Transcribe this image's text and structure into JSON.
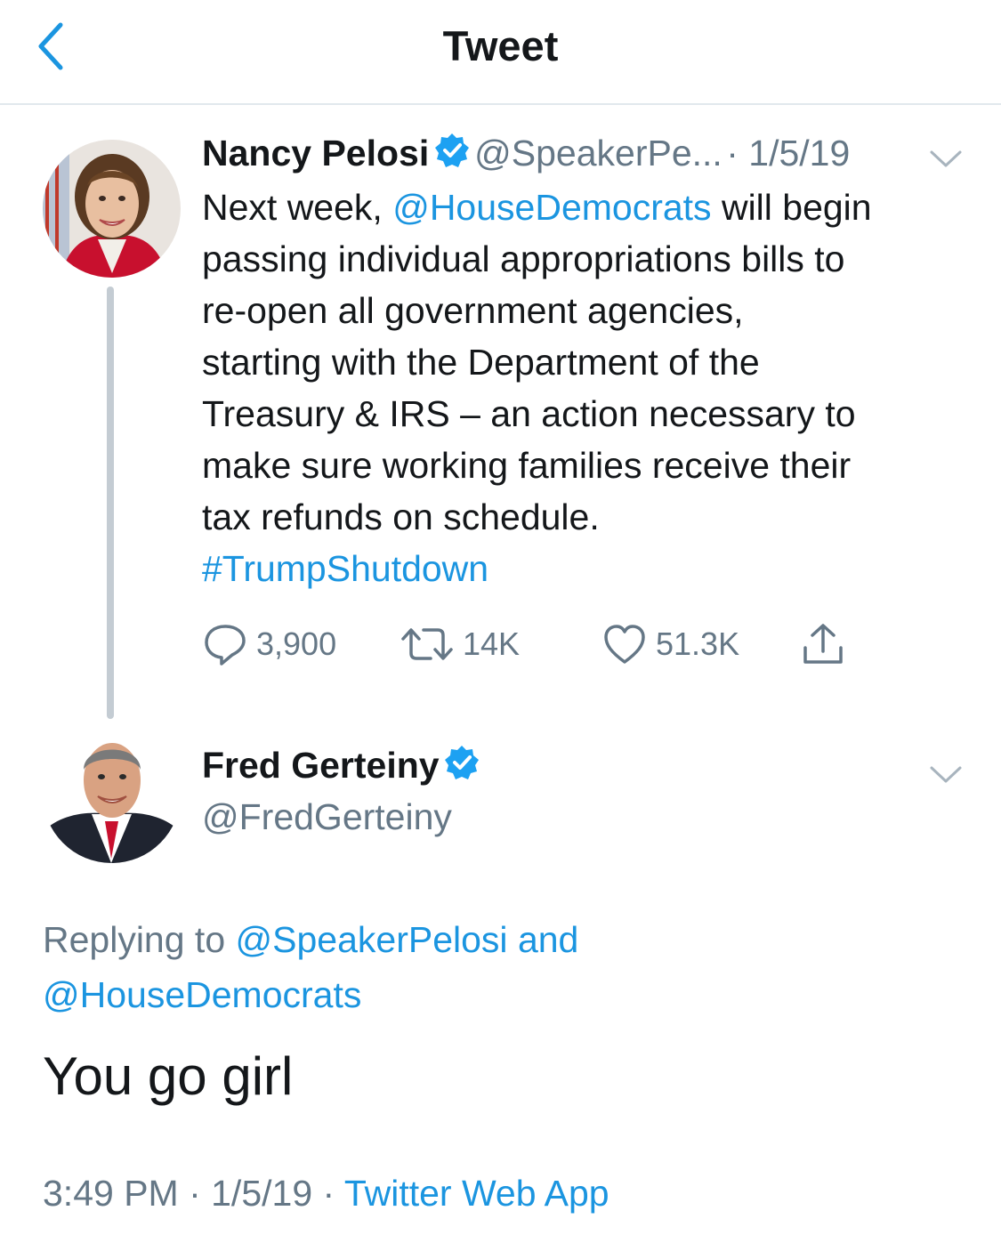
{
  "header": {
    "title": "Tweet",
    "back_icon": "chevron-left-icon"
  },
  "colors": {
    "link": "#1b95e0",
    "secondary": "#657786",
    "primary": "#14171a",
    "divider": "#e1e8ed"
  },
  "tweet": {
    "name": "Nancy Pelosi",
    "handle": "@SpeakerPe...",
    "date": "· 1/5/19",
    "lines": [
      {
        "pre": "Next week, ",
        "mention": "@HouseDemocrats",
        "post": " will begin"
      },
      {
        "text": "passing individual appropriations bills to"
      },
      {
        "text": "re-open all government agencies,"
      },
      {
        "text": "starting with the Department of the"
      },
      {
        "text": "Treasury & IRS – an action necessary to"
      },
      {
        "text": "make sure working families receive their"
      },
      {
        "text": "tax refunds on schedule."
      }
    ],
    "hashtag": "#TrumpShutdown",
    "stats": {
      "replies": "3,900",
      "retweets": "14K",
      "likes": "51.3K"
    }
  },
  "reply": {
    "name": "Fred Gerteiny",
    "handle": "@FredGerteiny",
    "replying_prefix": "Replying to",
    "replying_user1": "@SpeakerPelosi",
    "replying_and": "and",
    "replying_user2": "@HouseDemocrats",
    "text": "You go girl",
    "time": "3:49 PM · 1/5/19 · ",
    "source": "Twitter Web App"
  }
}
